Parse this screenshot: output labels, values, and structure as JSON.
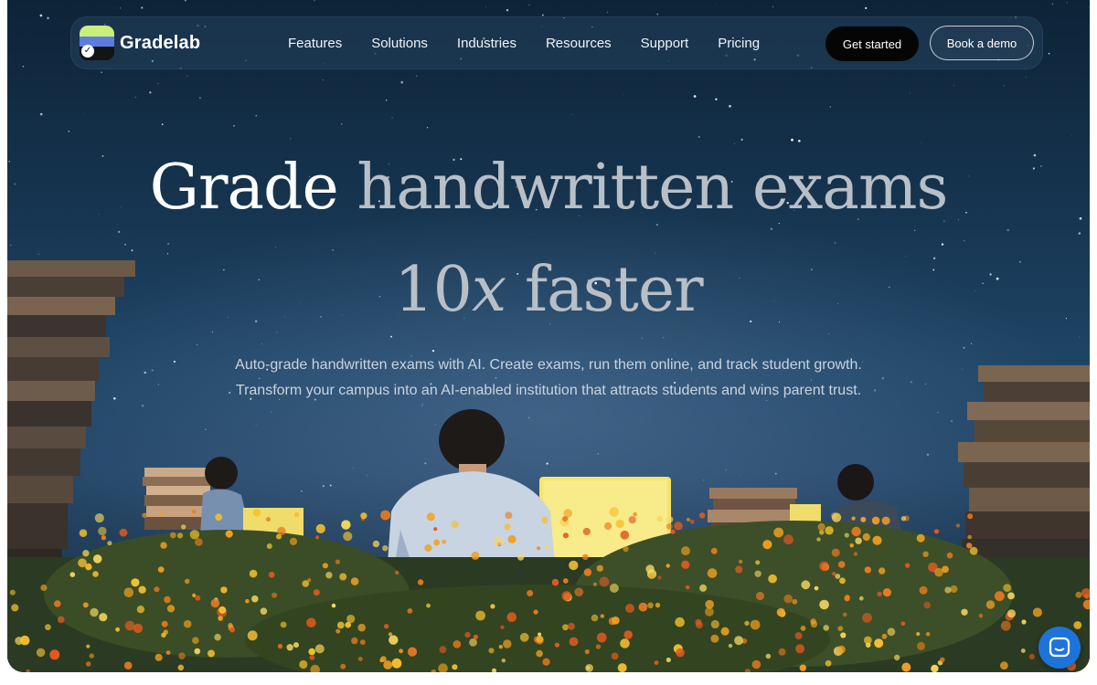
{
  "nav": {
    "brand": "Gradelab",
    "links": [
      "Features",
      "Solutions",
      "Industries",
      "Resources",
      "Support",
      "Pricing"
    ],
    "get_started": "Get started",
    "book_demo": "Book a demo"
  },
  "hero": {
    "headline_word1": "Grade",
    "headline_rest1": "handwritten exams",
    "headline_num": "10",
    "headline_x": "x",
    "headline_rest2": "faster",
    "subtext": "Auto-grade handwritten exams with AI. Create exams, run them online, and track student growth. Transform your campus into an AI-enabled institution that attracts students and wins parent trust."
  },
  "icons": {
    "logo": "gradelab-logo-icon",
    "chat": "chat-icon"
  },
  "colors": {
    "sky_top": "#0d2338",
    "sky_mid": "#1f4566",
    "logo_green": "#c8ef7c",
    "logo_blue": "#5b7de0",
    "button_black": "#050505",
    "chat_blue": "#1e73d8",
    "flower_orange": "#f0a020",
    "screen_yellow": "#f4e46a"
  }
}
